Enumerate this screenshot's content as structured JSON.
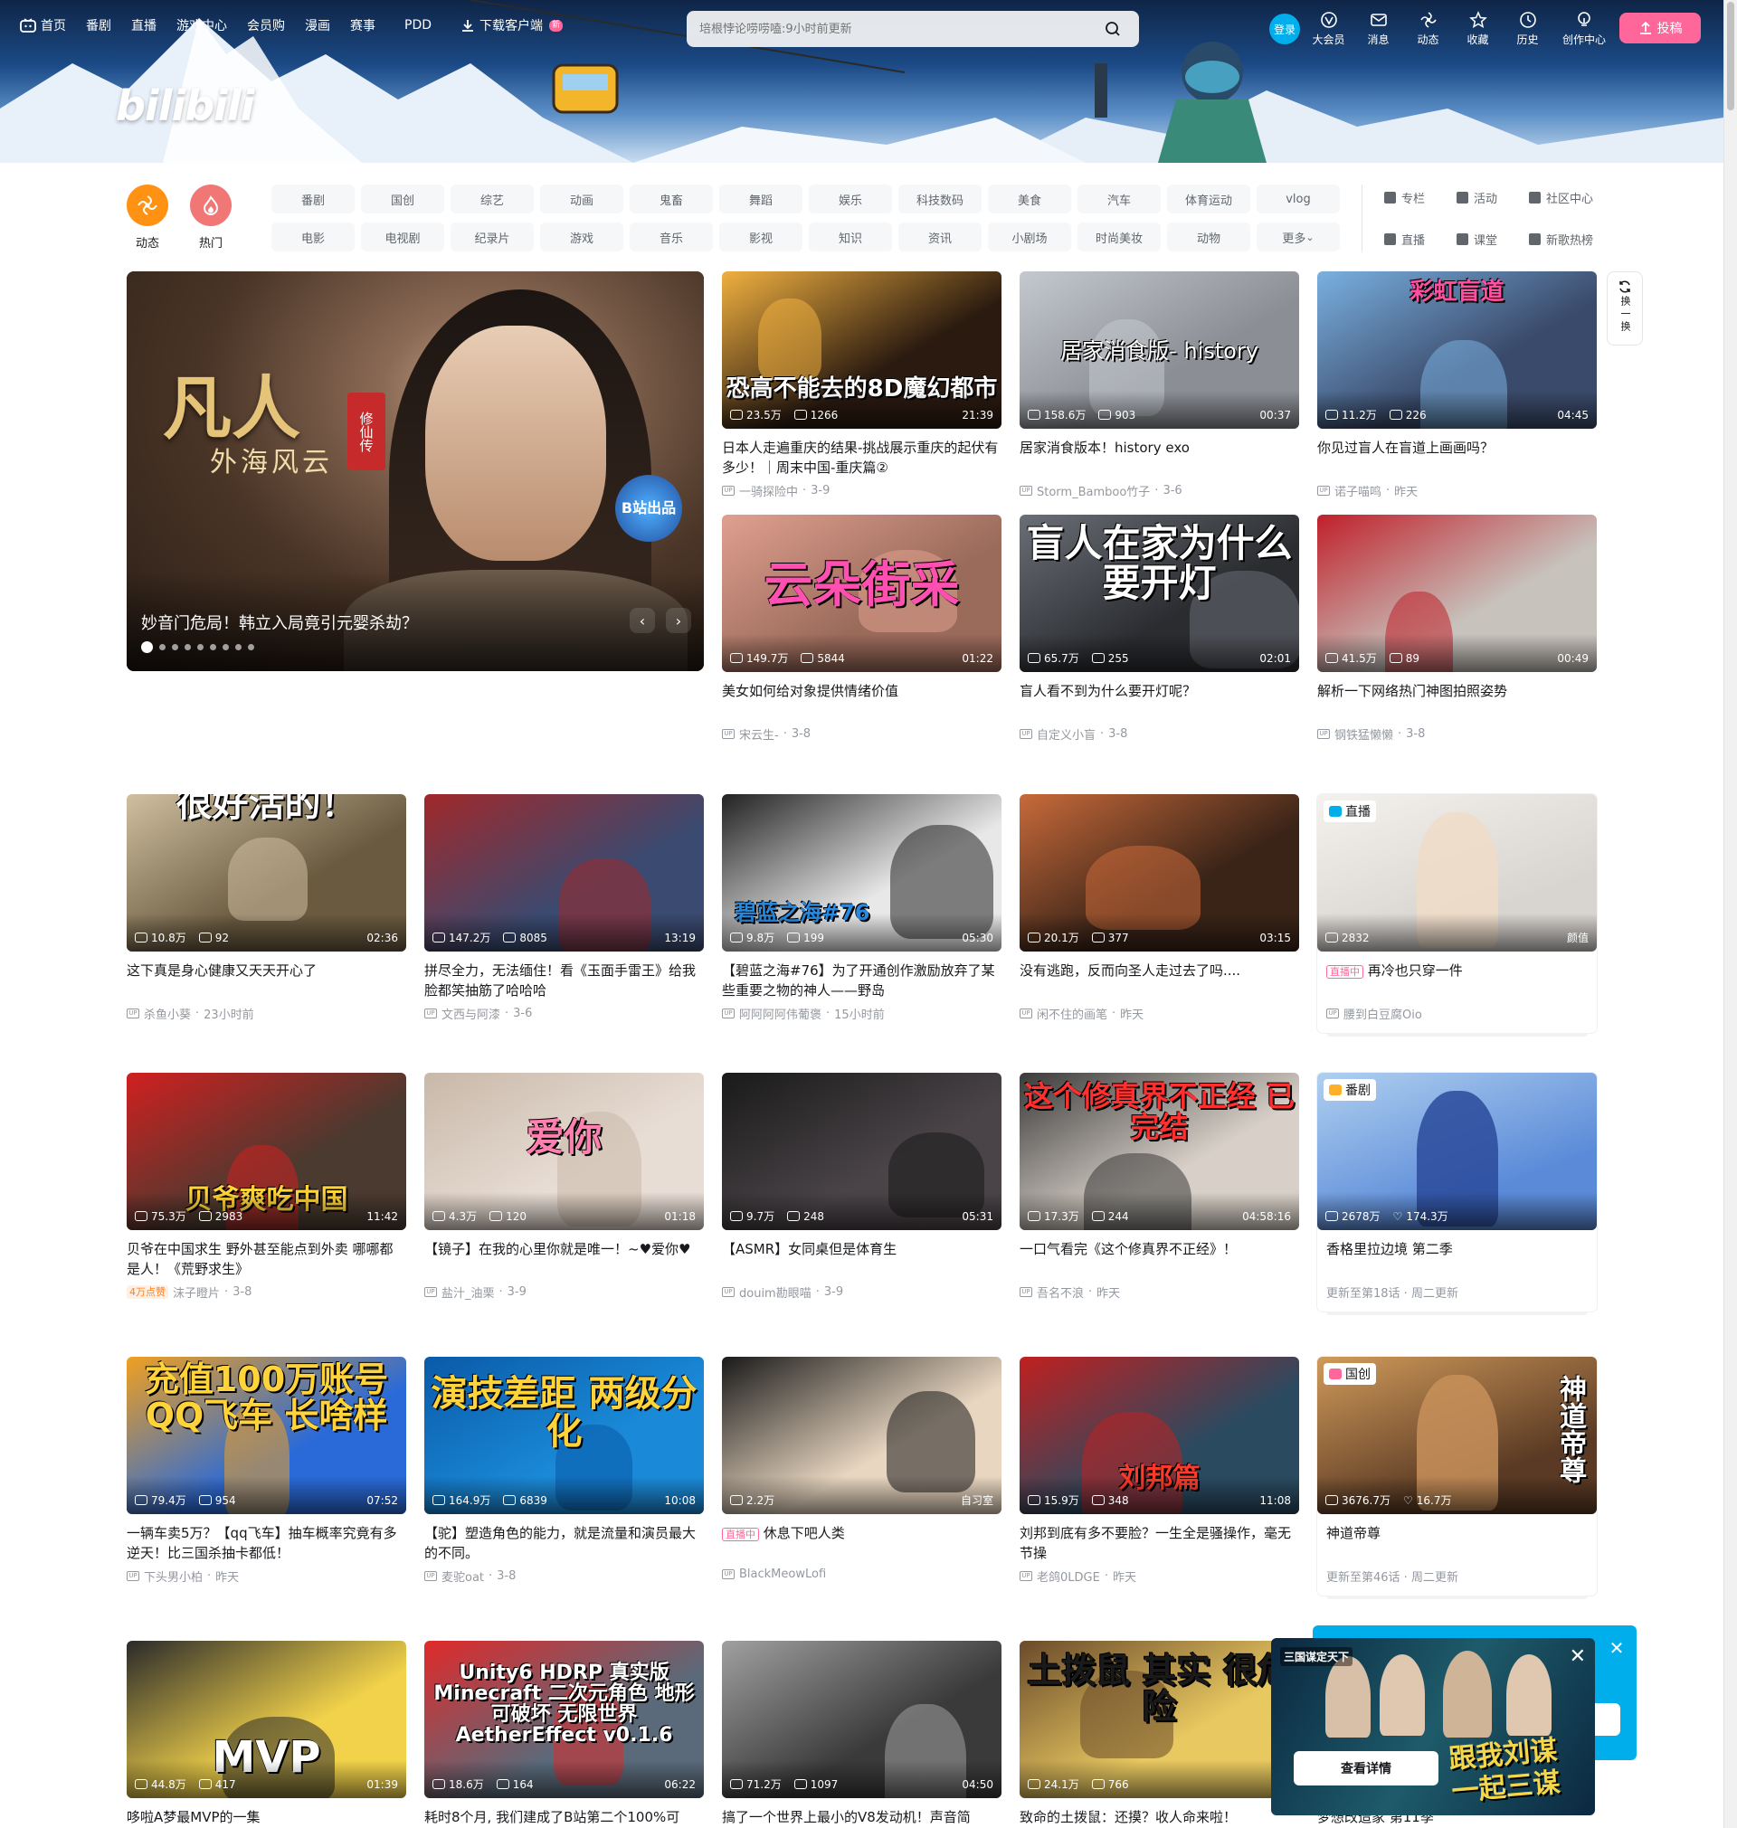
{
  "nav": {
    "left": [
      {
        "label": "首页",
        "icon": "tv-icon"
      },
      {
        "label": "番剧"
      },
      {
        "label": "直播"
      },
      {
        "label": "游戏中心"
      },
      {
        "label": "会员购"
      },
      {
        "label": "漫画"
      },
      {
        "label": "赛事"
      },
      {
        "label": "PDD"
      },
      {
        "label": "下载客户端",
        "icon": "download-icon",
        "badge": "新"
      }
    ],
    "search_placeholder": "培根悖论唠唠嗑:9小时前更新",
    "login": "登录",
    "right": [
      {
        "label": "大会员",
        "icon": "vip-icon"
      },
      {
        "label": "消息",
        "icon": "message-icon"
      },
      {
        "label": "动态",
        "icon": "dynamic-icon"
      },
      {
        "label": "收藏",
        "icon": "star-icon"
      },
      {
        "label": "历史",
        "icon": "history-icon"
      },
      {
        "label": "创作中心",
        "icon": "bulb-icon"
      }
    ],
    "upload": "投稿"
  },
  "brand": {
    "logo": "bilibili"
  },
  "channels": {
    "big": [
      {
        "label": "动态",
        "color": "#ff9212"
      },
      {
        "label": "热门",
        "color": "#f07775"
      }
    ],
    "chips": [
      "番剧",
      "国创",
      "综艺",
      "动画",
      "鬼畜",
      "舞蹈",
      "娱乐",
      "科技数码",
      "美食",
      "汽车",
      "体育运动",
      "vlog",
      "电影",
      "电视剧",
      "纪录片",
      "游戏",
      "音乐",
      "影视",
      "知识",
      "资讯",
      "小剧场",
      "时尚美妆",
      "动物",
      "更多"
    ],
    "side": [
      "专栏",
      "活动",
      "社区中心",
      "直播",
      "课堂",
      "新歌热榜"
    ]
  },
  "carousel": {
    "caption": "妙音门危局！韩立入局竟引元婴杀劫？",
    "art_title": "凡人",
    "art_subtitle": "外海风云",
    "seal": "修仙传",
    "badge": "B站出品",
    "dots": 9,
    "active": 1
  },
  "refresh": {
    "label": "换一换"
  },
  "videos": [
    {
      "title": "日本人走遍重庆的结果-挑战展示重庆的起伏有多少！｜周末中国-重庆篇②",
      "views": "23.5万",
      "danmaku": "1266",
      "duration": "21:39",
      "up": "一骑探险中",
      "date": "3-9",
      "overlay": "恐高不能去的8D魔幻都市",
      "bg": "#2a1a10",
      "fg": "#ffffff",
      "accent": "#f0b040"
    },
    {
      "title": "居家消食版本！history exo",
      "views": "158.6万",
      "danmaku": "903",
      "duration": "00:37",
      "up": "Storm_Bamboo竹子",
      "date": "3-6",
      "overlay": "居家消食版- history",
      "bg": "#8b8e94",
      "fg": "#ffffff",
      "accent": "#c4c8cf"
    },
    {
      "title": "你见过盲人在盲道上画画吗？",
      "views": "11.2万",
      "danmaku": "226",
      "duration": "04:45",
      "up": "诺子喵鸣",
      "date": "昨天",
      "overlay": "彩虹盲道",
      "bg": "#3a4a6a",
      "fg": "#ff4fa0",
      "accent": "#7ab0e0"
    },
    {
      "title": "美女如何给对象提供情绪价值",
      "views": "149.7万",
      "danmaku": "5844",
      "duration": "01:22",
      "up": "宋云生-",
      "date": "3-8",
      "overlay": "云朵街采",
      "bg": "#9a6a5a",
      "fg": "#ff4fb0",
      "accent": "#e0a090"
    },
    {
      "title": "盲人看不到为什么要开灯呢？",
      "views": "65.7万",
      "danmaku": "255",
      "duration": "02:01",
      "up": "自定义小盲",
      "date": "3-8",
      "overlay": "盲人在家为什么要开灯",
      "bg": "#2a2c30",
      "fg": "#ffffff",
      "accent": "#6a6e76"
    },
    {
      "title": "解析一下网络热门神图拍照姿势",
      "views": "41.5万",
      "danmaku": "89",
      "duration": "00:49",
      "up": "钢铁猛懒懒",
      "date": "3-8",
      "overlay": "",
      "bg": "#c7c2bc",
      "fg": "#ffffff",
      "accent": "#c0202a"
    },
    {
      "title": "这下真是身心健康又天天开心了",
      "views": "10.8万",
      "danmaku": "92",
      "duration": "02:36",
      "up": "杀鱼小葵",
      "date": "23小时前",
      "overlay": "很好活的！",
      "bg": "#6a5a40",
      "fg": "#ffffff",
      "accent": "#d0c0a0"
    },
    {
      "title": "拼尽全力，无法缅住！看《玉面手雷王》给我脸都笑抽筋了哈哈哈",
      "views": "147.2万",
      "danmaku": "8085",
      "duration": "13:19",
      "up": "文西与阿漆",
      "date": "3-6",
      "overlay": "",
      "bg": "#3a4a70",
      "fg": "#ffffff",
      "accent": "#a0282a"
    },
    {
      "title": "【碧蓝之海#76】为了开通创作激励放弃了某些重要之物的神人——野岛",
      "views": "9.8万",
      "danmaku": "199",
      "duration": "05:30",
      "up": "阿阿阿阿伟葡褒",
      "date": "15小时前",
      "overlay": "碧蓝之海#76",
      "bg": "#e8e8e8",
      "fg": "#2a6ae0",
      "accent": "#222222"
    },
    {
      "title": "没有逃跑，反而向圣人走过去了吗....",
      "views": "20.1万",
      "danmaku": "377",
      "duration": "03:15",
      "up": "闲不住的画笔",
      "date": "昨天",
      "overlay": "",
      "bg": "#3a2418",
      "fg": "#ffffff",
      "accent": "#c86a3a"
    },
    {
      "title": "贝爷在中国求生 野外甚至能点到外卖 哪哪都是人！《荒野求生》",
      "views": "75.3万",
      "danmaku": "2983",
      "duration": "11:42",
      "up": "沫子瞪片",
      "date": "3-8",
      "badge": "4万点赞",
      "overlay": "贝爷爽吃中国",
      "bg": "#4a3a30",
      "fg": "#ffd43b",
      "accent": "#d02020"
    },
    {
      "title": "【镜子】在我的心里你就是唯一！~♥爱你♥",
      "views": "4.3万",
      "danmaku": "120",
      "duration": "01:18",
      "up": "盐汁_油栗",
      "date": "3-9",
      "overlay": "爱你",
      "bg": "#e8ddd5",
      "fg": "#ff7fb0",
      "accent": "#c8b8a8"
    },
    {
      "title": "【ASMR】女同桌但是体育生",
      "views": "9.7万",
      "danmaku": "248",
      "duration": "05:31",
      "up": "douim勘眼喵",
      "date": "3-9",
      "overlay": "",
      "bg": "#4a4448",
      "fg": "#ffffff",
      "accent": "#1a1a1a"
    },
    {
      "title": "一口气看完《这个修真界不正经》！",
      "views": "17.3万",
      "danmaku": "244",
      "duration": "04:58:16",
      "up": "吾名不浪",
      "date": "昨天",
      "overlay": "这个修真界不正经 已完结",
      "bg": "#d8d0c8",
      "fg": "#ff3030",
      "accent": "#3a3a3a"
    },
    {
      "title": "一辆车卖5万？【qq飞车】抽车概率究竟有多逆天！比三国杀抽卡都低！",
      "views": "79.4万",
      "danmaku": "954",
      "duration": "07:52",
      "up": "下头男小柏",
      "date": "昨天",
      "overlay": "充值100万账号 QQ飞车 长啥样",
      "bg": "#2a6ad8",
      "fg": "#ffd43b",
      "accent": "#f0a020"
    },
    {
      "title": "【驼】塑造角色的能力，就是流量和演员最大的不同。",
      "views": "164.9万",
      "danmaku": "6839",
      "duration": "10:08",
      "up": "麦驼oat",
      "date": "3-8",
      "overlay": "演技差距 两级分化",
      "bg": "#1a8ad8",
      "fg": "#ffd43b",
      "accent": "#0a5aa8"
    },
    {
      "title": "休息下吧人类",
      "views": "2.2万",
      "danmaku": "",
      "duration": "自习室",
      "up": "BlackMeowLofi",
      "date": "",
      "live_badge": "直播中",
      "overlay": "",
      "bg": "#e8d6c0",
      "fg": "#ffffff",
      "accent": "#1a1a1a"
    },
    {
      "title": "刘邦到底有多不要脸？一生全是骚操作，毫无节操",
      "views": "15.9万",
      "danmaku": "348",
      "duration": "11:08",
      "up": "老鸽0LDGE",
      "date": "昨天",
      "overlay": "刘邦篇",
      "bg": "#2a4a60",
      "fg": "#ff3a2a",
      "accent": "#c02020"
    },
    {
      "title": "哆啦A梦最MVP的一集",
      "views": "44.8万",
      "danmaku": "417",
      "duration": "01:39",
      "up": "",
      "date": "",
      "overlay": "MVP",
      "bg": "#f2d24a",
      "fg": "#ffffff",
      "accent": "#2a2a2a"
    },
    {
      "title": "耗时8个月, 我们建成了B站第二个100%可",
      "views": "18.6万",
      "danmaku": "164",
      "duration": "06:22",
      "up": "",
      "date": "",
      "overlay": "Unity6 HDRP 真实版 Minecraft 二次元角色 地形可破坏 无限世界 AetherEffect v0.1.6",
      "bg": "#5a6a7a",
      "fg": "#ffffff",
      "accent": "#e02a2a"
    },
    {
      "title": "搞了一个世界上最小的V8发动机！声音简",
      "views": "71.2万",
      "danmaku": "1097",
      "duration": "04:50",
      "up": "",
      "date": "",
      "overlay": "",
      "bg": "#3a3a3a",
      "fg": "#ffffff",
      "accent": "#a0a0a0"
    },
    {
      "title": "致命的土拨鼠：还摸？收人命来啦！",
      "views": "24.1万",
      "danmaku": "766",
      "duration": "06:",
      "up": "",
      "date": "",
      "overlay": "土拨鼠 其实 很危险",
      "bg": "#e8c860",
      "fg": "#1a1a1a",
      "accent": "#6a4a2a"
    }
  ],
  "specials": [
    {
      "tag": "直播",
      "views": "2832",
      "right": "颜值",
      "title": "再冷也只穿一件",
      "live_badge": "直播中",
      "up": "腰到白豆腐Oio",
      "bg": "#d8d4d0",
      "accent": "#f4f2ee"
    },
    {
      "tag": "番剧",
      "views": "2678万",
      "likes": "174.3万",
      "title": "香格里拉边境 第二季",
      "sub": "更新至第18话 · 周二更新",
      "bg": "#5a8ad8",
      "accent": "#b0d0f0"
    },
    {
      "tag": "国创",
      "views": "3676.7万",
      "likes": "16.7万",
      "title": "神道帝尊",
      "sub": "更新至第46话 · 周二更新",
      "overlay": "神道帝尊",
      "bg": "#5a3a24",
      "accent": "#d09a5a"
    },
    {
      "title": "梦想改造家 第11季"
    }
  ],
  "popup": {
    "cta": "查看详情",
    "text": "跟我刘谋 一起三谋",
    "logo": "三国谋定天下"
  }
}
